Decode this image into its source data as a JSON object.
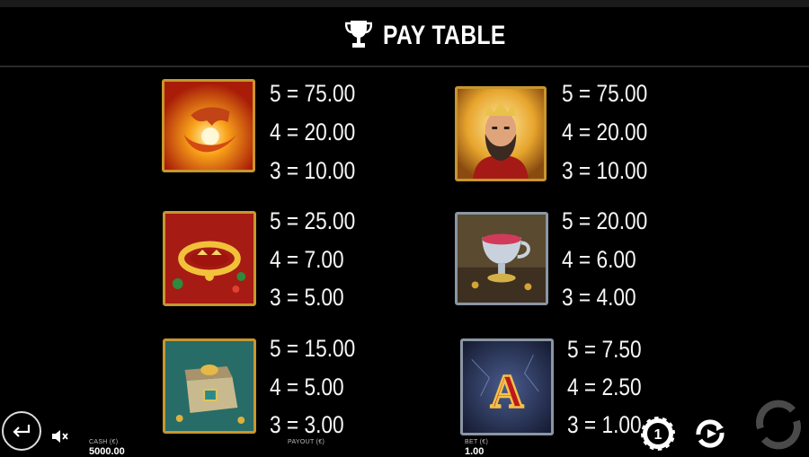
{
  "header": {
    "title": "PAY TABLE",
    "icon": "trophy-icon"
  },
  "symbols": [
    {
      "name": "hand-symbol",
      "payouts": [
        "5 = 75.00",
        "4 = 20.00",
        "3 = 10.00"
      ]
    },
    {
      "name": "king-symbol",
      "payouts": [
        "5 = 75.00",
        "4 = 20.00",
        "3 = 10.00"
      ]
    },
    {
      "name": "crown-symbol",
      "payouts": [
        "5 = 25.00",
        "4 = 7.00",
        "3 = 5.00"
      ]
    },
    {
      "name": "goblet-symbol",
      "payouts": [
        "5 = 20.00",
        "4 = 6.00",
        "3 = 4.00"
      ]
    },
    {
      "name": "chest-symbol",
      "payouts": [
        "5 = 15.00",
        "4 = 5.00",
        "3 = 3.00"
      ]
    },
    {
      "name": "ace-symbol",
      "letter": "A",
      "payouts": [
        "5 = 7.50",
        "4 = 2.50",
        "3 = 1.00"
      ]
    }
  ],
  "bottom_bar": {
    "cash_label": "CASH (€)",
    "cash_value": "5000.00",
    "payout_label": "PAYOUT (€)",
    "bet_label": "BET (€)",
    "bet_value": "1.00",
    "chip_value": "1"
  },
  "colors": {
    "gold_frame": "#c8962e",
    "silver_frame": "#8a96a4",
    "ace_red": "#c0181c"
  }
}
